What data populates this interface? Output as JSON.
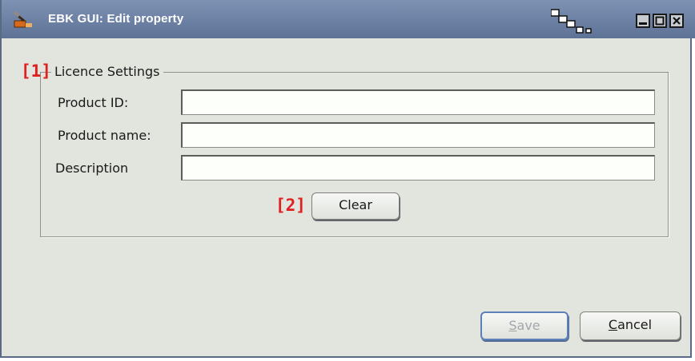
{
  "window": {
    "title": "EBK GUI: Edit property"
  },
  "colors": {
    "titlebar": "#6a7ea2",
    "background": "#e2e4de",
    "marker": "#e0201e",
    "focus_border": "#5b7fb6"
  },
  "markers": {
    "m1": "[1]",
    "m2": "[2]"
  },
  "licence_settings": {
    "title": "Licence Settings",
    "fields": [
      {
        "label": "Product ID:",
        "value": ""
      },
      {
        "label": "Product name:",
        "value": ""
      },
      {
        "label": "Description",
        "value": ""
      }
    ],
    "clear_label": "Clear"
  },
  "footer": {
    "save": {
      "mnemonic": "S",
      "rest": "ave",
      "enabled": false
    },
    "cancel": {
      "mnemonic": "C",
      "rest": "ancel"
    }
  },
  "icons": {
    "app": "hammer-icon",
    "decoration": "pixel-blocks-icon",
    "minimize": "minimize-icon",
    "maximize": "maximize-icon",
    "close": "close-icon"
  }
}
